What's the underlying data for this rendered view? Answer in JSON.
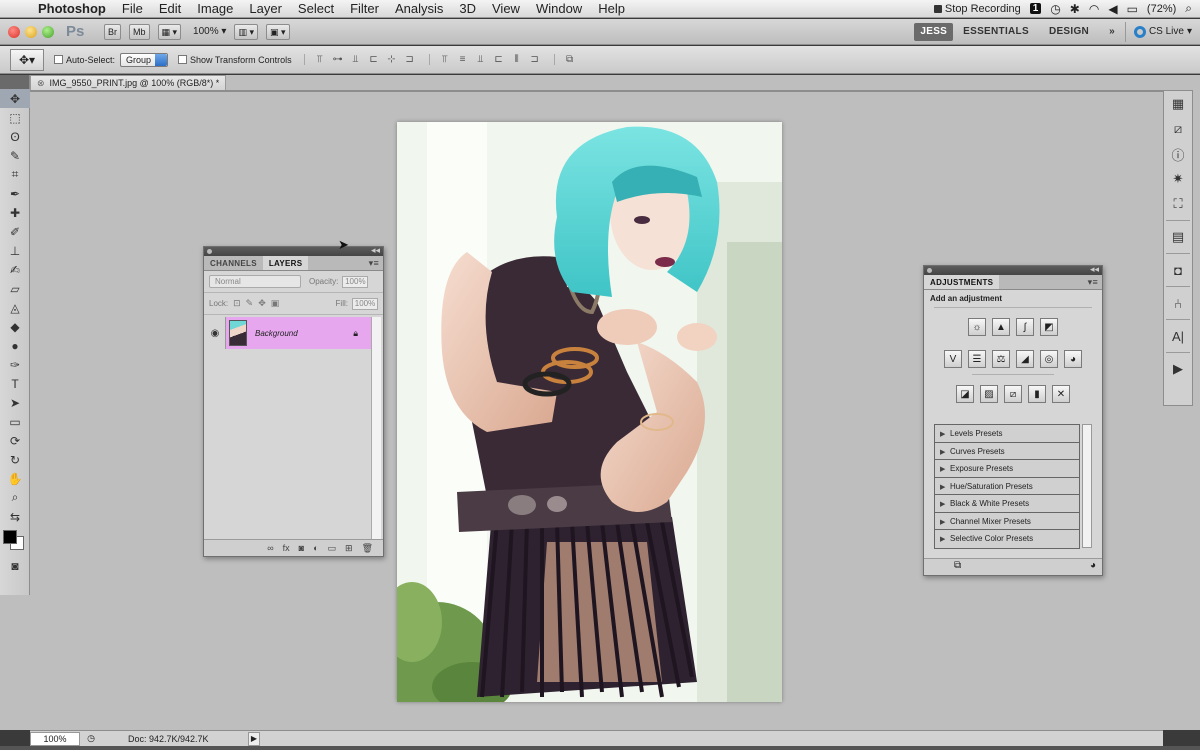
{
  "menubar": {
    "app_name": "Photoshop",
    "items": [
      "File",
      "Edit",
      "Image",
      "Layer",
      "Select",
      "Filter",
      "Analysis",
      "3D",
      "View",
      "Window",
      "Help"
    ],
    "stop_recording": "Stop Recording",
    "badge": "1",
    "battery": "(72%)"
  },
  "appbar": {
    "ps_logo": "Ps",
    "bridge_label": "Br",
    "mini_bridge_label": "Mb",
    "zoom": "100%",
    "workspaces": {
      "active": "JESS",
      "essentials": "ESSENTIALS",
      "design": "DESIGN",
      "more": "»"
    },
    "cs_live": "CS Live"
  },
  "options": {
    "auto_select_label": "Auto-Select:",
    "auto_select_value": "Group",
    "show_transform_label": "Show Transform Controls"
  },
  "document": {
    "tab_title": "IMG_9550_PRINT.jpg @ 100% (RGB/8*) *"
  },
  "layers_panel": {
    "tabs": [
      "CHANNELS",
      "LAYERS"
    ],
    "blend_mode": "Normal",
    "opacity_label": "Opacity:",
    "opacity_value": "100%",
    "lock_label": "Lock:",
    "fill_label": "Fill:",
    "fill_value": "100%",
    "layer_name": "Background"
  },
  "adjustments_panel": {
    "tab": "ADJUSTMENTS",
    "subtitle": "Add an adjustment",
    "presets": [
      "Levels Presets",
      "Curves Presets",
      "Exposure Presets",
      "Hue/Saturation Presets",
      "Black & White Presets",
      "Channel Mixer Presets",
      "Selective Color Presets"
    ]
  },
  "statusbar": {
    "zoom": "100%",
    "doc_info": "Doc: 942.7K/942.7K"
  },
  "colors": {
    "layer_highlight": "#e6a7ef",
    "workspace_bg": "#bebebe",
    "hair": "#55d4d4"
  },
  "icons": [
    "apple-icon",
    "move-tool-icon",
    "marquee-tool-icon",
    "lasso-tool-icon",
    "crop-tool-icon",
    "eye-icon",
    "lock-icon",
    "cs-live-icon"
  ]
}
